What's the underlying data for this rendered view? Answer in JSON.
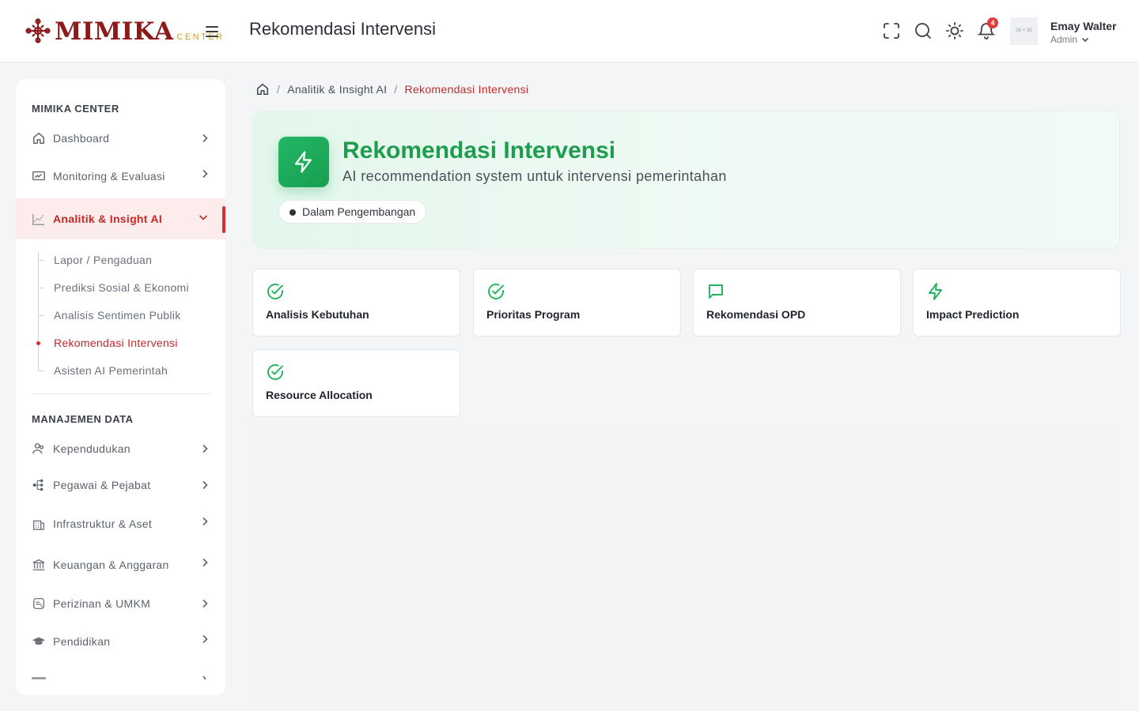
{
  "brand": {
    "name": "MIMIKA",
    "sub": "CENTER"
  },
  "header": {
    "title": "Rekomendasi Intervensi",
    "notification_count": "4",
    "avatar_placeholder": "35 × 35",
    "user_name": "Emay Walter",
    "user_role": "Admin"
  },
  "sidebar": {
    "section1": "MIMIKA CENTER",
    "items1": [
      {
        "label": "Dashboard",
        "icon": "home-icon"
      },
      {
        "label": "Monitoring & Evaluasi",
        "icon": "monitor-icon"
      },
      {
        "label": "Analitik & Insight AI",
        "icon": "chart-icon"
      }
    ],
    "sub_items": [
      {
        "label": "Lapor / Pengaduan"
      },
      {
        "label": "Prediksi Sosial & Ekonomi"
      },
      {
        "label": "Analisis Sentimen Publik"
      },
      {
        "label": "Rekomendasi Intervensi"
      },
      {
        "label": "Asisten AI Pemerintah"
      }
    ],
    "section2": "MANAJEMEN DATA",
    "items2": [
      {
        "label": "Kependudukan",
        "icon": "users-icon"
      },
      {
        "label": "Pegawai & Pejabat",
        "icon": "org-chart-icon"
      },
      {
        "label": "Infrastruktur & Aset",
        "icon": "building-icon"
      },
      {
        "label": "Keuangan & Anggaran",
        "icon": "bank-icon"
      },
      {
        "label": "Perizinan & UMKM",
        "icon": "license-icon"
      },
      {
        "label": "Pendidikan",
        "icon": "graduation-cap-icon"
      }
    ]
  },
  "breadcrumb": {
    "parent": "Analitik & Insight AI",
    "current": "Rekomendasi Intervensi"
  },
  "hero": {
    "title": "Rekomendasi Intervensi",
    "subtitle": "AI recommendation system untuk intervensi pemerintahan",
    "status": "Dalam Pengembangan"
  },
  "features": [
    {
      "label": "Analisis Kebutuhan",
      "icon": "check-circle-icon"
    },
    {
      "label": "Prioritas Program",
      "icon": "check-circle-icon"
    },
    {
      "label": "Rekomendasi OPD",
      "icon": "message-icon"
    },
    {
      "label": "Impact Prediction",
      "icon": "lightning-icon"
    },
    {
      "label": "Resource Allocation",
      "icon": "check-circle-icon"
    }
  ],
  "colors": {
    "accent_red": "#c62828",
    "accent_green": "#1f9d4f",
    "brand": "#8b1a1a"
  }
}
